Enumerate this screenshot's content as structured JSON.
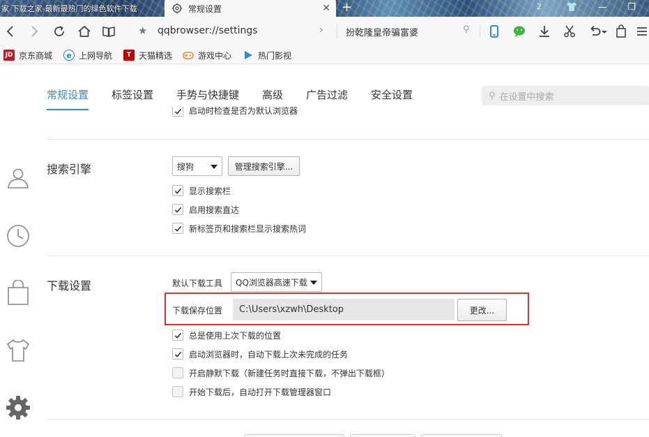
{
  "tabs": {
    "inactive_title": "家  下载之家-最新最热门的绿色软件下载",
    "active_title": "常规设置",
    "count": "2"
  },
  "navbar": {
    "address": "qqbrowser://settings",
    "search_hint": "扮乾隆皇帝骗富婆"
  },
  "bookmarks": [
    {
      "label": "京东商城",
      "icon": "JD",
      "color": "#c91623"
    },
    {
      "label": "上网导航",
      "icon": "e",
      "color": "#1e7fd9"
    },
    {
      "label": "天猫精选",
      "icon": "T",
      "color": "#c40000"
    },
    {
      "label": "游戏中心",
      "icon": "gamepad-icon",
      "color": "#e88a2a"
    },
    {
      "label": "热门影视",
      "icon": "play-icon",
      "color": "#2a8de0"
    }
  ],
  "settings_tabs": [
    {
      "label": "常规设置",
      "active": true
    },
    {
      "label": "标签设置",
      "active": false
    },
    {
      "label": "手势与快捷键",
      "active": false
    },
    {
      "label": "高级",
      "active": false
    },
    {
      "label": "广告过滤",
      "active": false
    },
    {
      "label": "安全设置",
      "active": false
    }
  ],
  "settings_search_placeholder": "在设置中搜索",
  "top_partial": {
    "label": "启动时检查是否为默认浏览器",
    "checked": true
  },
  "search_engine": {
    "title": "搜索引擎",
    "selected": "搜狗",
    "manage_button": "管理搜索引擎...",
    "options": [
      {
        "label": "显示搜索栏",
        "checked": true
      },
      {
        "label": "启用搜索直达",
        "checked": true
      },
      {
        "label": "新标签页和搜索栏显示搜索热词",
        "checked": true
      }
    ]
  },
  "download": {
    "title": "下载设置",
    "tool_label": "默认下载工具",
    "tool_selected": "QQ浏览器高速下载",
    "path_label": "下载保存位置",
    "path_value": "C:\\Users\\xzwh\\Desktop",
    "change_button": "更改...",
    "options": [
      {
        "label": "总是使用上次下载的位置",
        "checked": true
      },
      {
        "label": "启动浏览器时，自动下载上次未完成的任务",
        "checked": true
      },
      {
        "label": "开启静默下载（新建任务时直接下载，不弹出下载框）",
        "checked": false
      },
      {
        "label": "开始下载后，自动打开下载管理器窗口",
        "checked": false
      }
    ]
  },
  "colors": {
    "accent": "#2e8bd9",
    "highlight_border": "#e0302e"
  }
}
